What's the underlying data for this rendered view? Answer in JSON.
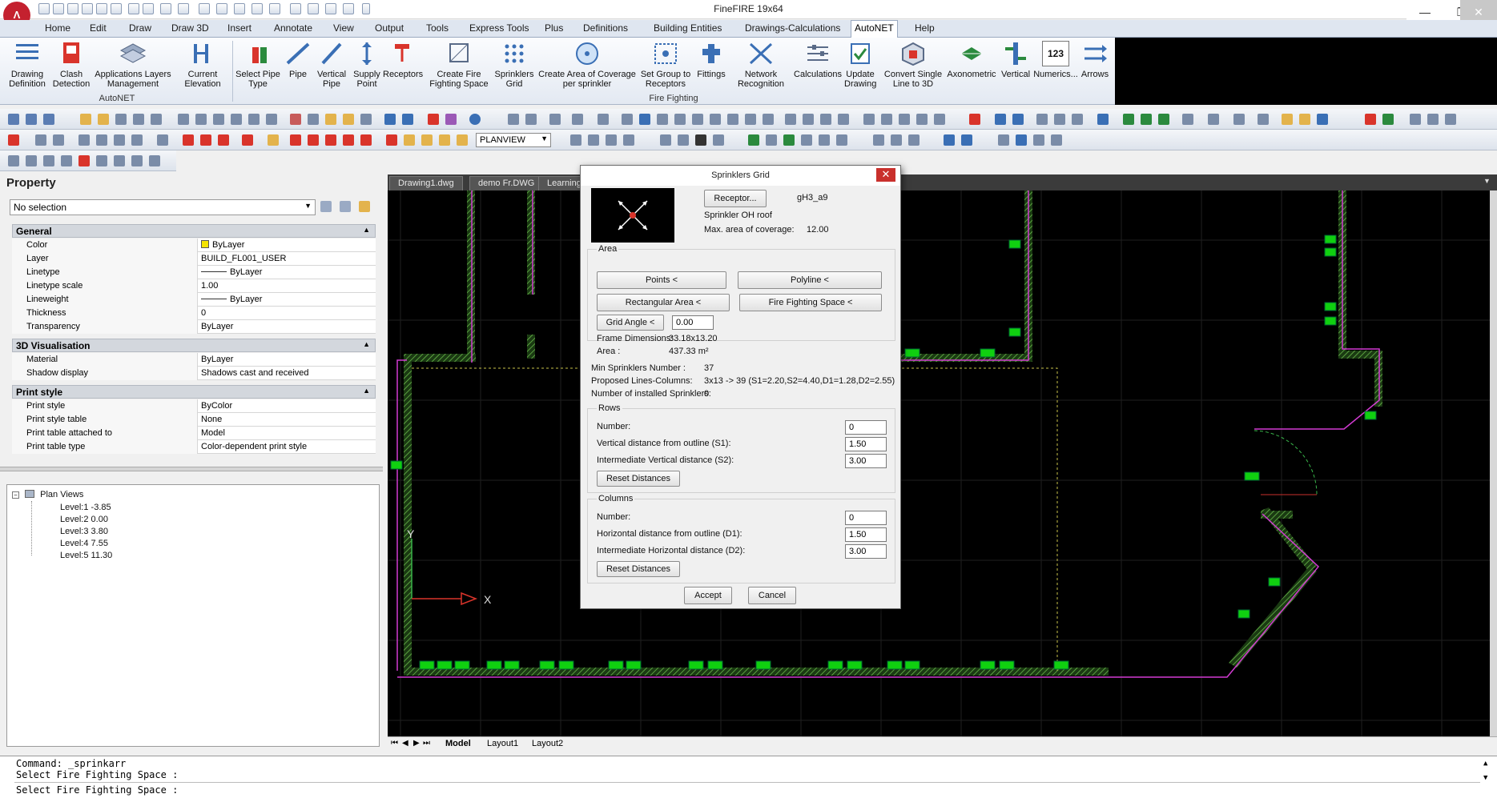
{
  "app": {
    "title": "FineFIRE 19x64",
    "logo_text": "Λ"
  },
  "menu": {
    "tabs": [
      "Home",
      "Edit",
      "Draw",
      "Draw 3D",
      "Insert",
      "Annotate",
      "View",
      "Output",
      "Tools",
      "Express Tools",
      "Plus",
      "Definitions",
      "Building Entities",
      "Drawings-Calculations",
      "AutoNET",
      "Help"
    ],
    "active": "AutoNET"
  },
  "ribbon": {
    "groups": [
      {
        "label": "AutoNET",
        "buttons": [
          "Drawing Definition",
          "Clash Detection",
          "Applications Layers Management",
          "Current Elevation"
        ]
      },
      {
        "label": "Fire Fighting",
        "buttons": [
          "Select Pipe Type",
          "Pipe",
          "Vertical Pipe",
          "Supply Point",
          "Receptors",
          "Create Fire Fighting Space",
          "Sprinklers Grid",
          "Create Area of Coverage per sprinkler",
          "Set Group to Receptors",
          "Fittings",
          "Network Recognition",
          "Calculations",
          "Update Drawing",
          "Convert Single Line to 3D",
          "Axonometric",
          "Vertical",
          "Numerics...",
          "Arrows"
        ]
      }
    ],
    "numerics_icon_text": "123"
  },
  "toolbar": {
    "view_select": "PLANVIEW"
  },
  "property": {
    "header": "Property",
    "selection": "No selection",
    "groups": [
      {
        "title": "General",
        "rows": [
          {
            "key": "Color",
            "value": "ByLayer"
          },
          {
            "key": "Layer",
            "value": "BUILD_FL001_USER"
          },
          {
            "key": "Linetype",
            "value": "ByLayer"
          },
          {
            "key": "Linetype scale",
            "value": "1.00"
          },
          {
            "key": "Lineweight",
            "value": "ByLayer"
          },
          {
            "key": "Thickness",
            "value": "0"
          },
          {
            "key": "Transparency",
            "value": "ByLayer"
          }
        ]
      },
      {
        "title": "3D Visualisation",
        "rows": [
          {
            "key": "Material",
            "value": "ByLayer"
          },
          {
            "key": "Shadow display",
            "value": "Shadows cast and received"
          }
        ]
      },
      {
        "title": "Print style",
        "rows": [
          {
            "key": "Print style",
            "value": "ByColor"
          },
          {
            "key": "Print style table",
            "value": "None"
          },
          {
            "key": "Print table attached to",
            "value": "Model"
          },
          {
            "key": "Print table type",
            "value": "Color-dependent print style"
          }
        ]
      }
    ]
  },
  "tree": {
    "root": "Plan Views",
    "levels": [
      {
        "name": "Level:1",
        "elev": "-3.85"
      },
      {
        "name": "Level:2",
        "elev": "0.00"
      },
      {
        "name": "Level:3",
        "elev": "3.80"
      },
      {
        "name": "Level:4",
        "elev": "7.55"
      },
      {
        "name": "Level:5",
        "elev": "11.30"
      }
    ]
  },
  "doc_tabs": [
    "Drawing1.dwg",
    "demo Fr.DWG",
    "Learning"
  ],
  "layout_tabs": [
    "Model",
    "Layout1",
    "Layout2"
  ],
  "command": {
    "lines": [
      "Command: _sprinkarr",
      "Select Fire Fighting Space :"
    ],
    "prompt": "Select Fire Fighting Space :"
  },
  "canvas": {
    "ucs_y": "Y",
    "ucs_x": "X"
  },
  "dialog": {
    "title": "Sprinklers Grid",
    "close": "✕",
    "receptor_button": "Receptor...",
    "receptor_code": "gH3_a9",
    "receptor_name": "Sprinkler OH roof",
    "max_area_label": "Max. area of coverage:",
    "max_area_value": "12.00",
    "area_section": "Area",
    "points_button": "Points <",
    "polyline_button": "Polyline <",
    "rect_button": "Rectangular Area <",
    "ffs_button": "Fire Fighting Space <",
    "grid_angle_button": "Grid Angle <",
    "grid_angle_value": "0.00",
    "frame_dim_label": "Frame Dimensions:",
    "frame_dim_value": "33.18x13.20",
    "area_label": "Area :",
    "area_value": "437.33 m²",
    "min_sprinklers_label": "Min Sprinklers Number :",
    "min_sprinklers_value": "37",
    "proposed_label": "Proposed Lines-Columns:",
    "proposed_value": "3x13 -> 39 (S1=2.20,S2=4.40,D1=1.28,D2=2.55)",
    "installed_label": "Number of installed Sprinklers:",
    "installed_value": "0",
    "rows_section": "Rows",
    "rows_number_label": "Number:",
    "rows_number_value": "0",
    "rows_s1_label": "Vertical distance from outline (S1):",
    "rows_s1_value": "1.50",
    "rows_s2_label": "Intermediate Vertical distance (S2):",
    "rows_s2_value": "3.00",
    "reset_label": "Reset Distances",
    "cols_section": "Columns",
    "cols_number_label": "Number:",
    "cols_number_value": "0",
    "cols_d1_label": "Horizontal distance from outline (D1):",
    "cols_d1_value": "1.50",
    "cols_d2_label": "Intermediate Horizontal distance (D2):",
    "cols_d2_value": "3.00",
    "accept": "Accept",
    "cancel": "Cancel"
  }
}
